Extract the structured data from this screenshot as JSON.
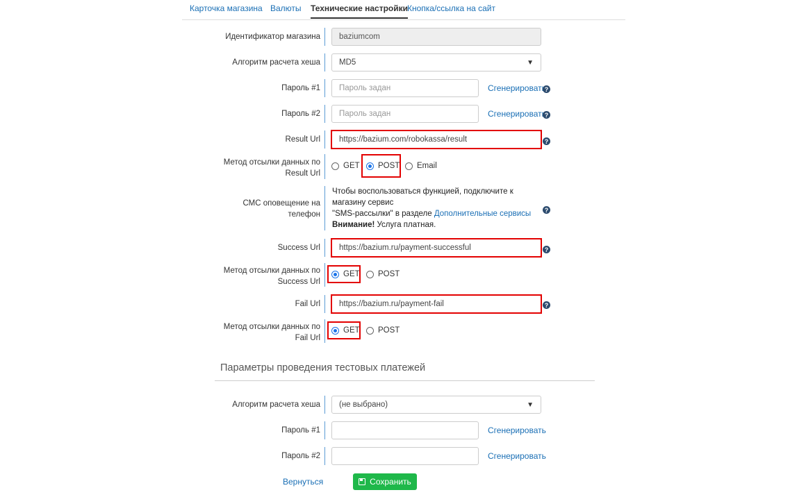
{
  "tabs": [
    "Карточка магазина",
    "Валюты",
    "Технические настройки",
    "Кнопка/ссылка на сайт"
  ],
  "labels": {
    "shop_id": "Идентификатор магазина",
    "hash_algo": "Алгоритм расчета хеша",
    "password1": "Пароль #1",
    "password2": "Пароль #2",
    "result_url": "Result Url",
    "result_method": "Метод отсылки данных по Result Url",
    "sms": "СМС оповещение на телефон",
    "success_url": "Success Url",
    "success_method": "Метод отсылки данных по Success Url",
    "fail_url": "Fail Url",
    "fail_method": "Метод отсылки данных по Fail Url"
  },
  "values": {
    "shop_id": "baziumcom",
    "hash_algo": "MD5",
    "password1_placeholder": "Пароль задан",
    "password2_placeholder": "Пароль задан",
    "result_url": "https://bazium.com/robokassa/result",
    "success_url": "https://bazium.ru/payment-successful",
    "fail_url": "https://bazium.ru/payment-fail"
  },
  "generate_label": "Сгенерировать",
  "methods": {
    "get": "GET",
    "post": "POST",
    "email": "Email"
  },
  "selected": {
    "result": "POST",
    "success": "GET",
    "fail": "GET"
  },
  "sms": {
    "line1": "Чтобы воспользоваться функцией, подключите к магазину сервис",
    "line2a": "\"SMS-рассылки\" в разделе ",
    "line2_link": "Дополнительные сервисы",
    "warn_bold": "Внимание!",
    "warn_text": " Услуга платная."
  },
  "test_section": {
    "title": "Параметры проведения тестовых платежей",
    "hash_algo_label": "Алгоритм расчета хеша",
    "hash_algo_value": "(не выбрано)",
    "password1_label": "Пароль #1",
    "password2_label": "Пароль #2"
  },
  "footer": {
    "back": "Вернуться",
    "save": "Сохранить"
  },
  "colors": {
    "link": "#1a6fb5",
    "highlight": "#e30000",
    "save_button": "#1fb84a"
  }
}
